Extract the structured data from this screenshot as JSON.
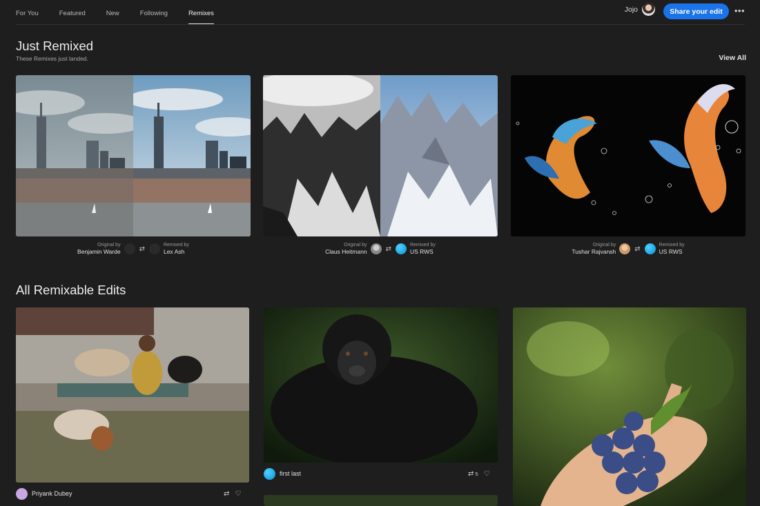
{
  "nav": {
    "tabs": [
      "For You",
      "Featured",
      "New",
      "Following",
      "Remixes"
    ],
    "active_tab": "Remixes",
    "user_name": "Jojo",
    "share_label": "Share your edit",
    "more_icon": "more-horizontal-icon"
  },
  "just_remixed": {
    "title": "Just Remixed",
    "subtitle": "These Remixes just landed.",
    "view_all": "View All",
    "cards": [
      {
        "original_label": "Original by",
        "original_name": "Benjamin Warde",
        "remixed_label": "Remixed by",
        "remixed_name": "Lex Ash"
      },
      {
        "original_label": "Original by",
        "original_name": "Claus Heitmann",
        "remixed_label": "Remixed by",
        "remixed_name": "US RWS"
      },
      {
        "original_label": "Original by",
        "original_name": "Tushar Rajvansh",
        "remixed_label": "Remixed by",
        "remixed_name": "US RWS"
      }
    ]
  },
  "all_edits": {
    "title": "All Remixable Edits",
    "cards": [
      {
        "user": "Priyank Dubey",
        "remix_count": ""
      },
      {
        "user": "first last",
        "remix_count": "5"
      }
    ]
  },
  "icons": {
    "remix": "remix-icon",
    "like": "heart-icon"
  }
}
